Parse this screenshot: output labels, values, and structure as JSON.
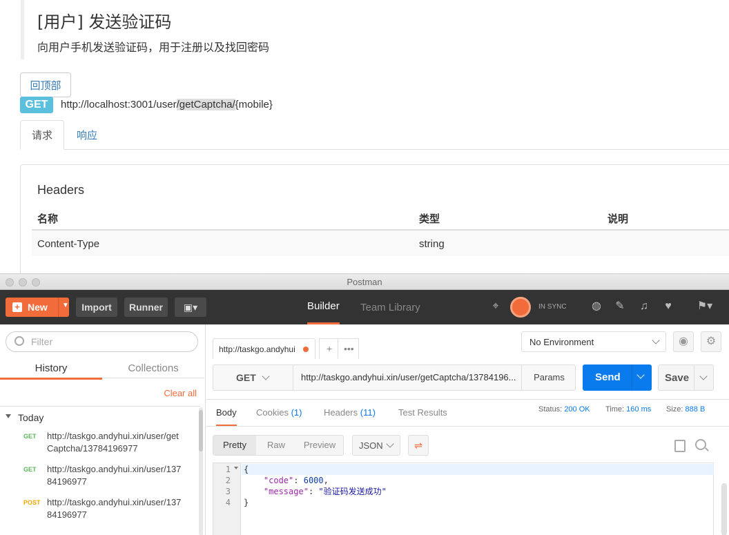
{
  "doc": {
    "title": "[用户] 发送验证码",
    "description": "向用户手机发送验证码，用于注册以及找回密码",
    "back_to_top": "回顶部",
    "method": "GET",
    "endpoint_prefix": "http://localhost:3001/user",
    "endpoint_highlight": "/getCaptcha/",
    "endpoint_suffix": "{mobile}",
    "tabs": [
      "请求",
      "响应"
    ],
    "headers_title": "Headers",
    "columns": [
      "名称",
      "类型",
      "说明"
    ],
    "rows": [
      [
        "Content-Type",
        "string",
        ""
      ]
    ]
  },
  "postman": {
    "window_title": "Postman",
    "toolbar": {
      "new_label": "New",
      "import_label": "Import",
      "runner_label": "Runner",
      "builder_label": "Builder",
      "team_library_label": "Team Library",
      "sync_status": "IN SYNC"
    },
    "sidebar": {
      "filter_placeholder": "Filter",
      "tabs": [
        "History",
        "Collections"
      ],
      "clear_all": "Clear all",
      "group": "Today",
      "history": [
        {
          "method": "GET",
          "url": "http://taskgo.andyhui.xin/user/getCaptcha/13784196977",
          "color": "#5cb85c"
        },
        {
          "method": "GET",
          "url": "http://taskgo.andyhui.xin/user/13784196977",
          "color": "#5cb85c"
        },
        {
          "method": "POST",
          "url": "http://taskgo.andyhui.xin/user/13784196977",
          "color": "#f0a700"
        }
      ]
    },
    "request": {
      "tab_title": "http://taskgo.andyhui",
      "environment": "No Environment",
      "method": "GET",
      "url": "http://taskgo.andyhui.xin/user/getCaptcha/13784196...",
      "params_label": "Params",
      "send_label": "Send",
      "save_label": "Save"
    },
    "response": {
      "tabs": {
        "body": "Body",
        "cookies": "Cookies",
        "cookies_count": "(1)",
        "headers": "Headers",
        "headers_count": "(11)",
        "test_results": "Test Results"
      },
      "status_label": "Status:",
      "status_value": "200 OK",
      "time_label": "Time:",
      "time_value": "160 ms",
      "size_label": "Size:",
      "size_value": "888 B",
      "format_modes": [
        "Pretty",
        "Raw",
        "Preview"
      ],
      "format": "JSON",
      "line_numbers": [
        "1",
        "2",
        "3",
        "4"
      ],
      "open_brace": "{",
      "close_brace": "}",
      "code_key": "\"code\"",
      "code_value": "6000",
      "message_key": "\"message\"",
      "message_value": "\"验证码发送成功\""
    },
    "colors": {
      "accent": "#f26b3a",
      "send": "#097bed",
      "get_badge": "#5bc0de"
    }
  }
}
